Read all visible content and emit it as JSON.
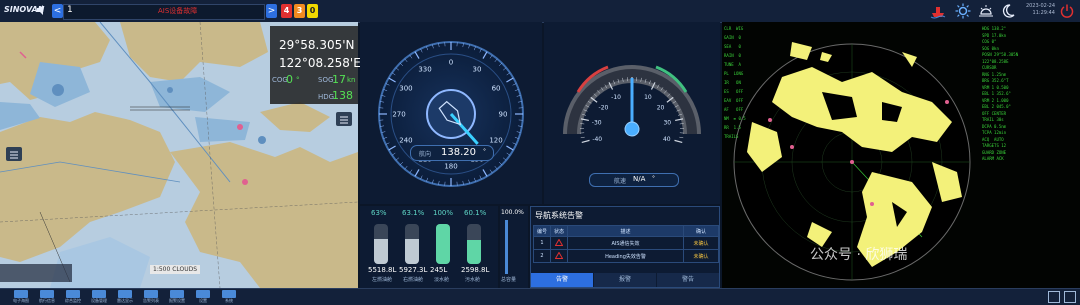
{
  "topbar": {
    "logo": "SINOVAN",
    "page_prev": "<",
    "page_number": "1",
    "alarm_text": "AIS设备故障",
    "page_next": ">",
    "counts": {
      "red": "4",
      "orange": "3",
      "yellow": "0"
    },
    "date": "2023-02-24",
    "time": "11:29:44"
  },
  "chart": {
    "latitude": "29°58.305'N",
    "longitude": "122°08.258'E",
    "cog_label": "COG",
    "cog_value": "0",
    "cog_unit": "°",
    "sog_label": "SOG",
    "sog_value": "17",
    "sog_unit": "kn",
    "hdg_label": "HDG",
    "hdg_value": "138",
    "scale_label": "1:500 CLOUDS"
  },
  "compass": {
    "ticks": [
      "0",
      "30",
      "60",
      "90",
      "120",
      "150",
      "180",
      "210",
      "240",
      "270",
      "300",
      "330"
    ],
    "heading_label": "航向",
    "heading_value": "138.20",
    "heading_unit": "°",
    "heading_deg": 138.2
  },
  "speed": {
    "ticks": [
      "-40",
      "-30",
      "-20",
      "-10",
      "0",
      "10",
      "20",
      "30",
      "40"
    ],
    "label": "航速",
    "value": "N/A",
    "unit": "°"
  },
  "tanks": [
    {
      "pct": "63%",
      "volume": "5518.8L",
      "name": "左燃油舱",
      "fill": 0.63,
      "color": "#bfcad3"
    },
    {
      "pct": "63.1%",
      "volume": "5927.3L",
      "name": "右燃油舱",
      "fill": 0.631,
      "color": "#bfcad3"
    },
    {
      "pct": "100%",
      "volume": "245L",
      "name": "淡水舱",
      "fill": 1.0,
      "color": "#5fd6a6"
    },
    {
      "pct": "60.1%",
      "volume": "2598.8L",
      "name": "污水舱",
      "fill": 0.601,
      "color": "#5fd6a6"
    }
  ],
  "capacity": {
    "pct": "100.0%",
    "label": "总容量"
  },
  "alarms": {
    "title": "导航系统告警",
    "headers": [
      "编号",
      "状态",
      "描述",
      "确认"
    ],
    "rows": [
      {
        "no": "1",
        "desc": "AIS通信失效",
        "ack": "未确认"
      },
      {
        "no": "2",
        "desc": "Heading失效告警",
        "ack": "未确认"
      }
    ],
    "tabs": [
      "告警",
      "报警",
      "警告"
    ]
  },
  "radar": {
    "left_lines": [
      "CLR  WIG",
      "GAIN  0",
      "SEA   0",
      "RAIN  0",
      "TUNE  A",
      "PL  LONG",
      "IR   ON",
      "ES   OFF",
      "EAV  OFF",
      "AF   OFF",
      "NM  ≡ 0.5",
      "RR  1.5",
      "TRAILS"
    ],
    "right_lines": [
      "HDG 138.2°",
      "SPD 17.0kn",
      "COG 0°",
      "SOG 0kn",
      "POSN 29°58.305N",
      "122°08.258E",
      "CURSOR",
      "RNG 1.25nm",
      "BRG 352.6°T",
      "VRM 1 0.500",
      "EBL 1 352.6°",
      "VRM 2 1.000",
      "EBL 2 045.0°",
      "OFF CENTER",
      "TRAIL 30s",
      "DCPA 0.5nm",
      "TCPA 12min",
      "ACQ  AUTO",
      "TARGETS 12",
      "GUARD ZONE",
      "ALARM ACK"
    ],
    "watermark": "公众号 · 欣狮瑞"
  },
  "bottombar": {
    "items": [
      "电子海图",
      "航行信息",
      "综合监控",
      "设备管理",
      "雷达显示",
      "告警列表",
      "报警设置",
      "设置",
      "系统"
    ]
  },
  "colors": {
    "accent": "#2d6fe0",
    "alarm_red": "#e03030",
    "radar_echo": "#f3f17a",
    "radar_text": "#3ad43a"
  }
}
